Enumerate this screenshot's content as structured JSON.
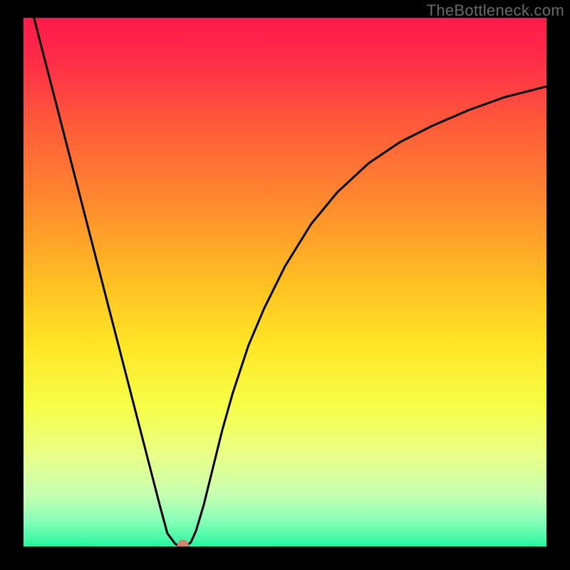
{
  "watermark": "TheBottleneck.com",
  "chart_data": {
    "type": "line",
    "title": "",
    "xlabel": "",
    "ylabel": "",
    "xlim": [
      0,
      100
    ],
    "ylim": [
      0,
      100
    ],
    "background_gradient": {
      "stops": [
        {
          "offset": 0.0,
          "color": "#ff1a4b"
        },
        {
          "offset": 0.08,
          "color": "#ff2c47"
        },
        {
          "offset": 0.2,
          "color": "#ff5a3a"
        },
        {
          "offset": 0.35,
          "color": "#ff8a2e"
        },
        {
          "offset": 0.5,
          "color": "#ffbf22"
        },
        {
          "offset": 0.62,
          "color": "#ffe626"
        },
        {
          "offset": 0.74,
          "color": "#f6ff4a"
        },
        {
          "offset": 0.83,
          "color": "#e8ff8a"
        },
        {
          "offset": 0.9,
          "color": "#c8ffb0"
        },
        {
          "offset": 0.95,
          "color": "#8affb8"
        },
        {
          "offset": 1.0,
          "color": "#28f5a0"
        }
      ]
    },
    "series": [
      {
        "name": "bottleneck-curve",
        "color": "#000000",
        "stroke_width": 3,
        "x": [
          0.0,
          2.0,
          5.0,
          8.0,
          11.0,
          14.0,
          17.0,
          20.0,
          23.0,
          26.0,
          27.5,
          29.0,
          30.0,
          31.0,
          32.0,
          33.0,
          34.5,
          36.0,
          38.0,
          40.0,
          43.0,
          46.0,
          50.0,
          55.0,
          60.0,
          66.0,
          72.0,
          78.0,
          85.0,
          92.0,
          100.0
        ],
        "y": [
          108.0,
          100.0,
          88.5,
          77.0,
          65.5,
          54.0,
          42.5,
          31.0,
          19.5,
          8.0,
          2.5,
          0.5,
          0.0,
          0.0,
          0.8,
          3.0,
          8.0,
          14.0,
          22.0,
          29.0,
          38.0,
          45.0,
          53.0,
          61.0,
          67.0,
          72.5,
          76.5,
          79.5,
          82.5,
          85.0,
          87.0
        ]
      }
    ],
    "marker": {
      "name": "optimal-point",
      "x": 30.5,
      "y": 0.2,
      "r": 1.1,
      "color": "#d88070"
    }
  }
}
